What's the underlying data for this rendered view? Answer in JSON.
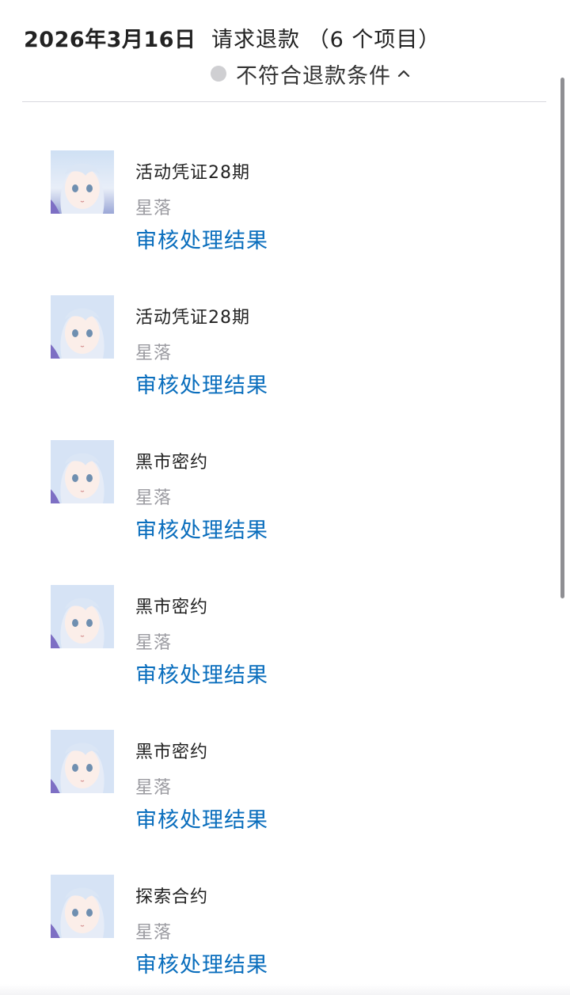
{
  "header": {
    "date": "2026年3月16日",
    "title": "请求退款 （6 个项目）",
    "status": "不符合退款条件",
    "status_dot_color": "#cfcfd2",
    "toggle_icon": "chevron-up-icon"
  },
  "items": [
    {
      "name": "活动凭证28期",
      "subtitle": "星落",
      "action": "审核处理结果",
      "icon": "anime-avatar-image"
    },
    {
      "name": "活动凭证28期",
      "subtitle": "星落",
      "action": "审核处理结果",
      "icon": "anime-avatar-image"
    },
    {
      "name": "黑市密约",
      "subtitle": "星落",
      "action": "审核处理结果",
      "icon": "anime-avatar-image"
    },
    {
      "name": "黑市密约",
      "subtitle": "星落",
      "action": "审核处理结果",
      "icon": "anime-avatar-image"
    },
    {
      "name": "黑市密约",
      "subtitle": "星落",
      "action": "审核处理结果",
      "icon": "anime-avatar-image"
    },
    {
      "name": "探索合约",
      "subtitle": "星落",
      "action": "审核处理结果",
      "icon": "anime-avatar-image"
    }
  ],
  "colors": {
    "link": "#0a6ebd",
    "text_primary": "#222222",
    "text_secondary": "#9a9aa0",
    "divider": "#d9d9de"
  }
}
